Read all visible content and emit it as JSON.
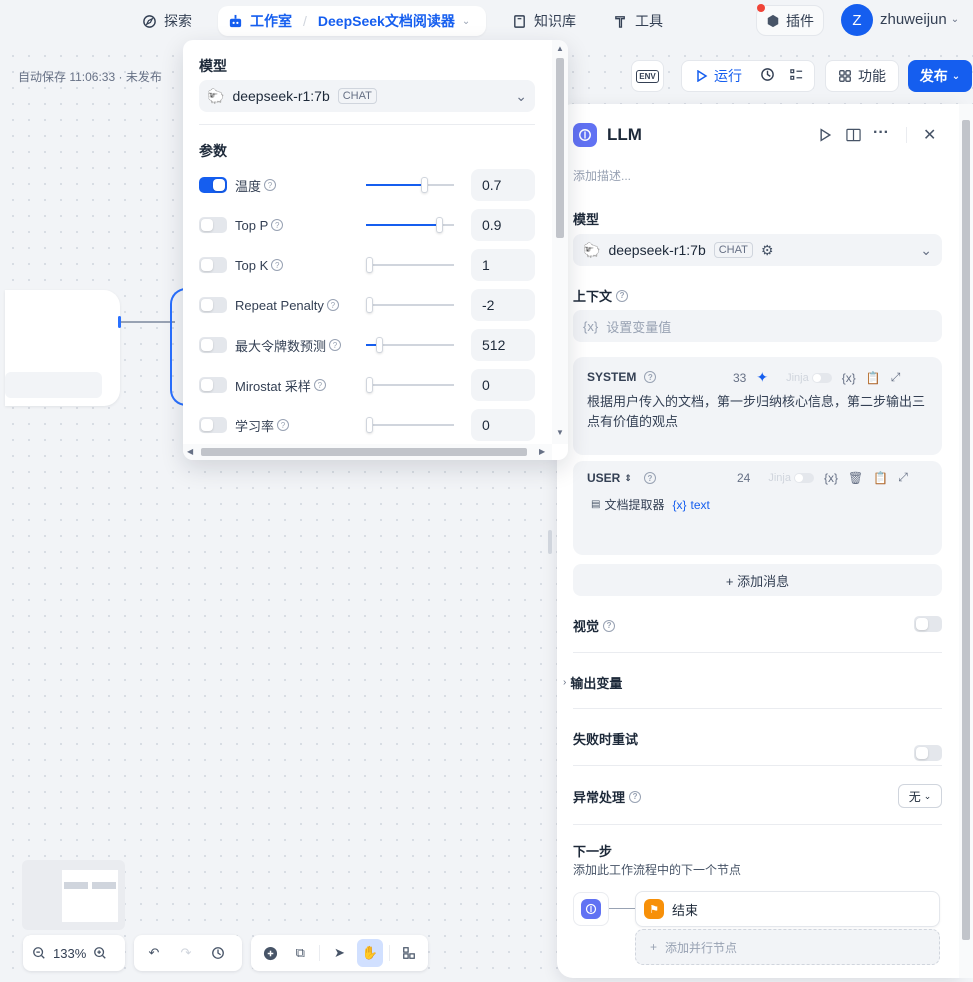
{
  "nav": {
    "explore": "探索",
    "studio": "工作室",
    "app_name": "DeepSeek文档阅读器",
    "knowledge": "知识库",
    "tools": "工具",
    "plugins": "插件",
    "avatar_letter": "Z",
    "username": "zhuweijun"
  },
  "canvas": {
    "autosave": "自动保存 11:06:33 · 未发布",
    "zoom": "133%"
  },
  "toolbar": {
    "env": "ENV",
    "run": "运行",
    "features": "功能",
    "publish": "发布"
  },
  "popover": {
    "model_label": "模型",
    "model_name": "deepseek-r1:7b",
    "model_mode": "CHAT",
    "params_label": "参数",
    "params": [
      {
        "name": "温度",
        "value": "0.7",
        "enabled": true,
        "level": 0.68
      },
      {
        "name": "Top P",
        "value": "0.9",
        "enabled": false,
        "level": 0.86
      },
      {
        "name": "Top K",
        "value": "1",
        "enabled": false,
        "level": 0.0
      },
      {
        "name": "Repeat Penalty",
        "value": "-2",
        "enabled": false,
        "level": 0.0
      },
      {
        "name": "最大令牌数预测",
        "value": "512",
        "enabled": false,
        "level": 0.12
      },
      {
        "name": "Mirostat 采样",
        "value": "0",
        "enabled": false,
        "level": 0.0
      },
      {
        "name": "学习率",
        "value": "0",
        "enabled": false,
        "level": 0.0
      }
    ]
  },
  "panel": {
    "title": "LLM",
    "description_placeholder": "添加描述...",
    "model_label": "模型",
    "model_name": "deepseek-r1:7b",
    "model_mode": "CHAT",
    "context_label": "上下文",
    "context_placeholder": "设置变量值",
    "system": {
      "role": "SYSTEM",
      "count": "33",
      "jinja": "Jinja",
      "text": "根据用户传入的文档，第一步归纳核心信息，第二步输出三点有价值的观点"
    },
    "user": {
      "role": "USER",
      "count": "24",
      "jinja": "Jinja",
      "var_node": "文档提取器",
      "var_name": "text"
    },
    "add_message": "+ 添加消息",
    "vision_label": "视觉",
    "output_vars_label": "输出变量",
    "retry_label": "失败时重试",
    "error_label": "异常处理",
    "error_value": "无",
    "next_step_label": "下一步",
    "next_step_desc": "添加此工作流程中的下一个节点",
    "next_node": "结束",
    "add_parallel": "添加并行节点"
  },
  "colors": {
    "accent": "#155eef",
    "llm_icon": "#6172f3",
    "end_icon": "#f79009",
    "notification": "#f04438"
  }
}
